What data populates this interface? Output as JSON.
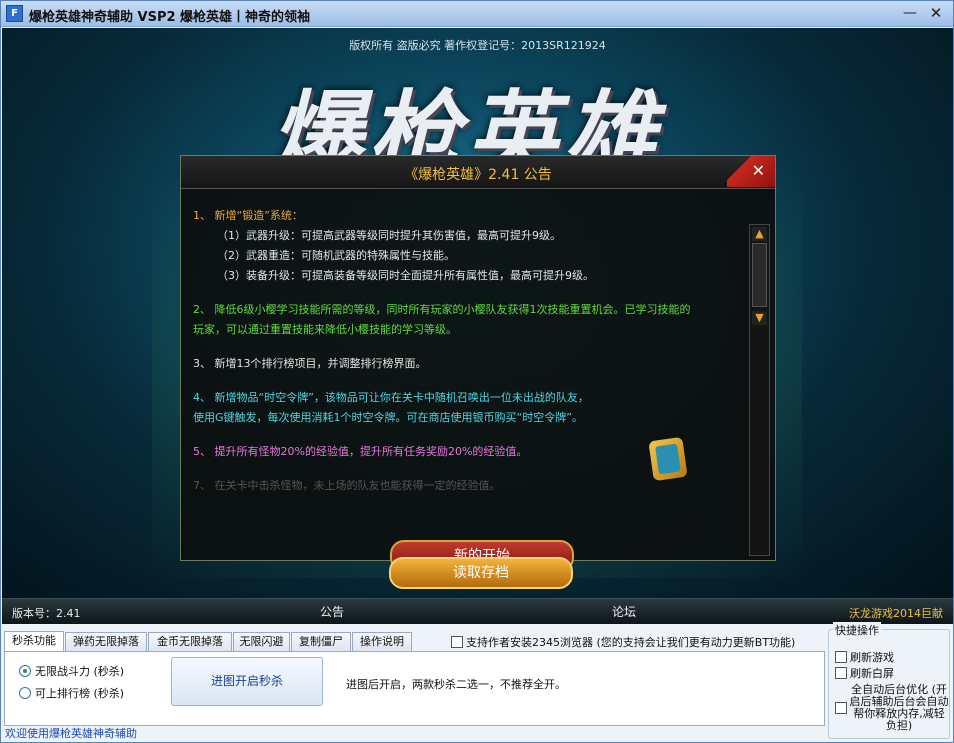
{
  "window": {
    "title": "爆枪英雄神奇辅助 VSP2 爆枪英雄丨神奇的领袖",
    "min_glyph": "—",
    "close_glyph": "✕"
  },
  "banner": {
    "copyright": "版权所有 盗版必究 著作权登记号：2013SR121924",
    "logo_text": "爆枪英雄"
  },
  "dialog": {
    "title": "《爆枪英雄》2.41 公告",
    "close_glyph": "✕",
    "notes": [
      {
        "color": "orange",
        "lines": [
          "1、 新增“锻造”系统："
        ],
        "sub": [
          "（1）武器升级：可提高武器等级同时提升其伤害值，最高可提升9级。",
          "（2）武器重造：可随机武器的特殊属性与技能。",
          "（3）装备升级：可提高装备等级同时全面提升所有属性值，最高可提升9级。"
        ]
      },
      {
        "color": "green",
        "lines": [
          "2、 降低6级小樱学习技能所需的等级，同时所有玩家的小樱队友获得1次技能重置机会。已学习技能的",
          "     玩家，可以通过重置技能来降低小樱技能的学习等级。"
        ]
      },
      {
        "color": "white",
        "lines": [
          "3、 新增13个排行榜项目，并调整排行榜界面。"
        ]
      },
      {
        "color": "cyan",
        "lines": [
          "4、 新增物品“时空令牌”，该物品可让你在关卡中随机召唤出一位未出战的队友，",
          "     使用G键触发，每次使用消耗1个时空令牌。可在商店使用银币购买“时空令牌”。"
        ]
      },
      {
        "color": "pink",
        "lines": [
          "5、 提升所有怪物20%的经验值，提升所有任务奖励20%的经验值。"
        ]
      },
      {
        "color": "dim",
        "lines": [
          "7、 在关卡中击杀怪物，未上场的队友也能获得一定的经验值。"
        ]
      }
    ]
  },
  "buttons": {
    "new_start": "新的开始",
    "load_save": "读取存档"
  },
  "info_bar": {
    "version": "版本号：2.41",
    "notice_tab": "公告",
    "forum_tab": "论坛",
    "credit": "沃龙游戏2014巨献"
  },
  "tabs": [
    {
      "label": "秒杀功能",
      "active": true
    },
    {
      "label": "弹药无限掉落",
      "active": false
    },
    {
      "label": "金币无限掉落",
      "active": false
    },
    {
      "label": "无限闪避",
      "active": false
    },
    {
      "label": "复制僵尸",
      "active": false
    },
    {
      "label": "操作说明",
      "active": false
    }
  ],
  "panel": {
    "radio_1": "无限战斗力 (秒杀)",
    "radio_2": "可上排行榜 (秒杀)",
    "selected": "radio_1",
    "action_button": "进图开启秒杀",
    "hint": "进图后开启，两款秒杀二选一，不推荐全开。"
  },
  "support_checkbox": "支持作者安装2345浏览器 (您的支持会让我们更有动力更新BT功能)",
  "quick_ops": {
    "title": "快捷操作",
    "refresh_game": "刷新游戏",
    "refresh_white": "刷新白屏",
    "auto_optimize": "全自动后台优化 (开启后辅助后台会自动帮你释放内存,减轻负担)"
  },
  "status": "欢迎使用爆枪英雄神奇辅助"
}
